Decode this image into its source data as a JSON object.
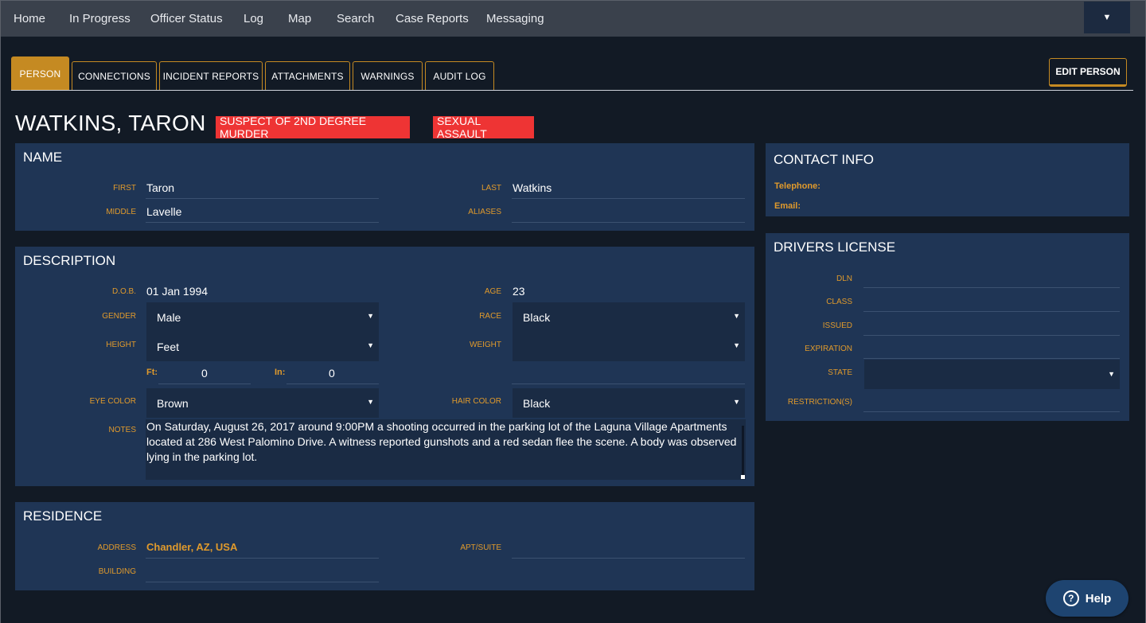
{
  "nav": {
    "items": [
      "Home",
      "In Progress",
      "Officer Status",
      "Log",
      "Map",
      "Search",
      "Case Reports",
      "Messaging"
    ],
    "dropdown_icon": "▼"
  },
  "tabs": [
    "PERSON",
    "CONNECTIONS",
    "INCIDENT REPORTS",
    "ATTACHMENTS",
    "WARNINGS",
    "AUDIT LOG"
  ],
  "edit_button": "EDIT PERSON",
  "person": {
    "full_name": "WATKINS, TARON",
    "badges": [
      "SUSPECT OF 2ND DEGREE MURDER",
      "SEXUAL ASSAULT"
    ]
  },
  "name_section": {
    "title": "NAME",
    "first_label": "FIRST",
    "first": "Taron",
    "last_label": "LAST",
    "last": "Watkins",
    "middle_label": "MIDDLE",
    "middle": "Lavelle",
    "aliases_label": "ALIASES",
    "aliases": ""
  },
  "description": {
    "title": "DESCRIPTION",
    "dob_label": "D.O.B.",
    "dob": "01 Jan 1994",
    "age_label": "AGE",
    "age": "23",
    "gender_label": "GENDER",
    "gender": "Male",
    "race_label": "RACE",
    "race": "Black",
    "height_label": "HEIGHT",
    "height_unit": "Feet",
    "weight_label": "WEIGHT",
    "weight": "",
    "ft_label": "Ft:",
    "ft": "0",
    "in_label": "In:",
    "in": "0",
    "eye_label": "EYE COLOR",
    "eye": "Brown",
    "hair_label": "HAIR COLOR",
    "hair": "Black",
    "notes_label": "NOTES",
    "notes": "On Saturday, August 26, 2017 around 9:00PM a shooting occurred in the parking lot of the Laguna Village Apartments located at 286 West Palomino Drive.  A witness reported gunshots and a red sedan flee the scene.  A body was observed lying in the parking lot."
  },
  "residence": {
    "title": "RESIDENCE",
    "address_label": "ADDRESS",
    "address": "Chandler, AZ, USA",
    "apt_label": "APT/SUITE",
    "apt": "",
    "building_label": "BUILDING",
    "building": ""
  },
  "contact": {
    "title": "CONTACT INFO",
    "telephone_label": "Telephone:",
    "email_label": "Email:"
  },
  "license": {
    "title": "DRIVERS LICENSE",
    "dln_label": "DLN",
    "class_label": "CLASS",
    "issued_label": "ISSUED",
    "expiration_label": "EXPIRATION",
    "state_label": "STATE",
    "restrictions_label": "RESTRICTION(S)"
  },
  "help": {
    "label": "Help",
    "icon": "?"
  },
  "colors": {
    "accent": "#c58a22",
    "panel": "#1f3555",
    "badge": "#ee3434",
    "nav": "#3a414c",
    "background": "#121a25"
  }
}
